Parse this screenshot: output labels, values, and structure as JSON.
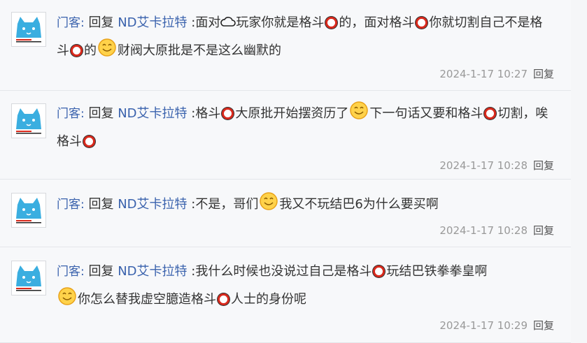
{
  "replies": [
    {
      "user": "门客:",
      "reply_word": "回复",
      "target": "ND艾卡拉特",
      "colon": ":",
      "segments": [
        "面对",
        "玩家你就是格斗",
        "的，面对格斗",
        "你就切割自己不是格斗",
        "的",
        "财阀大原批是不是这么幽默的"
      ],
      "date": "2024-1-17 10:27",
      "reply_label": "回复"
    },
    {
      "user": "门客:",
      "reply_word": "回复",
      "target": "ND艾卡拉特",
      "colon": ":",
      "segments": [
        "格斗",
        "大原批开始摆资历了",
        "下一句话又要和格斗",
        "切割，唉格斗"
      ],
      "date": "2024-1-17 10:28",
      "reply_label": "回复"
    },
    {
      "user": "门客:",
      "reply_word": "回复",
      "target": "ND艾卡拉特",
      "colon": ":",
      "segments": [
        "不是，哥们",
        "我又不玩结巴6为什么要买啊"
      ],
      "date": "2024-1-17 10:28",
      "reply_label": "回复"
    },
    {
      "user": "门客:",
      "reply_word": "回复",
      "target": "ND艾卡拉特",
      "colon": ":",
      "segments": [
        "我什么时候也没说过自己是格斗",
        "玩结巴铁拳拳皇啊",
        "你怎么替我虚空臆造格斗",
        "人士的身份呢"
      ],
      "date": "2024-1-17 10:29",
      "reply_label": "回复"
    }
  ],
  "icons": {
    "avatar": "blue-cat-avatar-icon",
    "circle": "red-circle-emoji-icon",
    "smile": "smile-emoji-icon",
    "cloud": "cloud-icon"
  },
  "colors": {
    "link": "#3a62ad",
    "text": "#333333",
    "meta": "#999999",
    "circle_red": "#d9291c"
  }
}
